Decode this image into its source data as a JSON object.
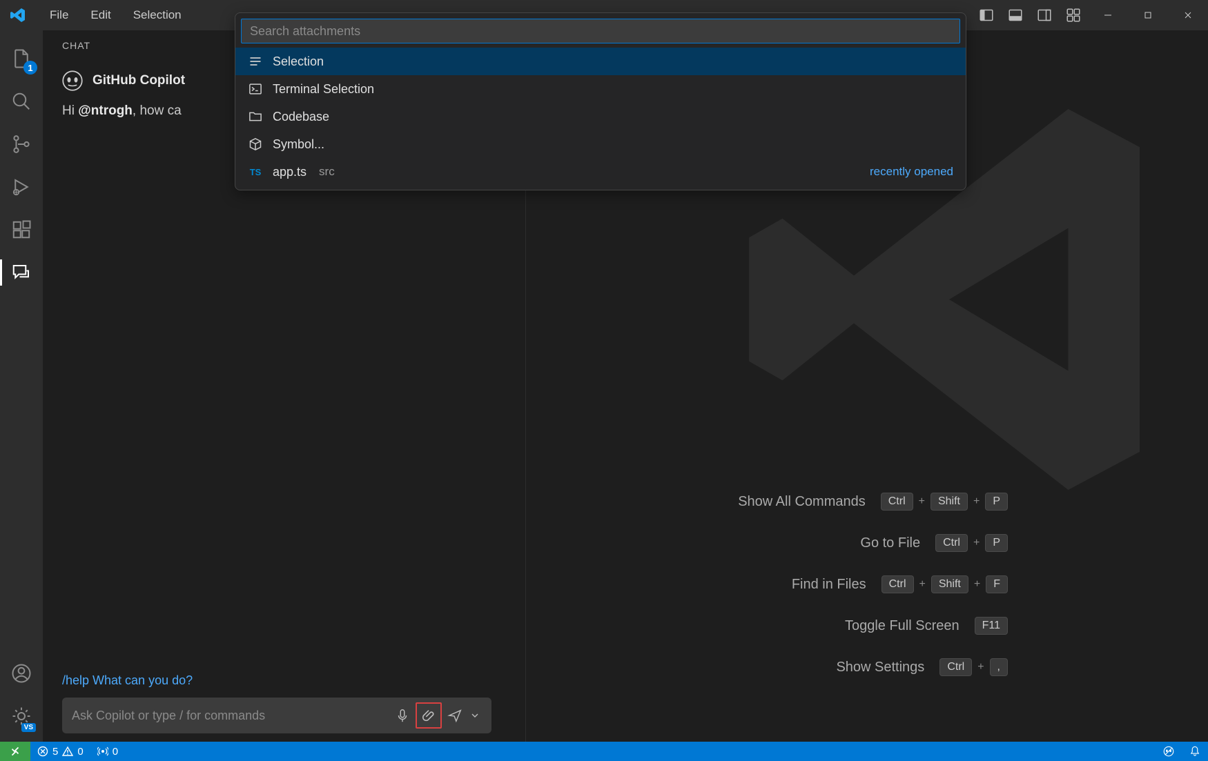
{
  "menu": {
    "items": [
      "File",
      "Edit",
      "Selection"
    ]
  },
  "activity": {
    "explorer_badge": "1"
  },
  "chat": {
    "header": "CHAT",
    "name": "GitHub Copilot",
    "greeting_prefix": "Hi ",
    "greeting_user": "@ntrogh",
    "greeting_suffix": ", how ca",
    "suggestion": "/help What can you do?",
    "input_placeholder": "Ask Copilot or type / for commands"
  },
  "quickpick": {
    "placeholder": "Search attachments",
    "items": [
      {
        "icon": "list",
        "label": "Selection",
        "selected": true
      },
      {
        "icon": "terminal",
        "label": "Terminal Selection"
      },
      {
        "icon": "folder",
        "label": "Codebase"
      },
      {
        "icon": "block",
        "label": "Symbol..."
      },
      {
        "icon": "ts",
        "label": "app.ts",
        "detail": "src",
        "right": "recently opened"
      }
    ]
  },
  "hints": [
    {
      "label": "Show All Commands",
      "keys": [
        "Ctrl",
        "Shift",
        "P"
      ]
    },
    {
      "label": "Go to File",
      "keys": [
        "Ctrl",
        "P"
      ]
    },
    {
      "label": "Find in Files",
      "keys": [
        "Ctrl",
        "Shift",
        "F"
      ]
    },
    {
      "label": "Toggle Full Screen",
      "keys": [
        "F11"
      ]
    },
    {
      "label": "Show Settings",
      "keys": [
        "Ctrl",
        ","
      ]
    }
  ],
  "status": {
    "errors": "5",
    "warnings": "0",
    "ports": "0"
  }
}
